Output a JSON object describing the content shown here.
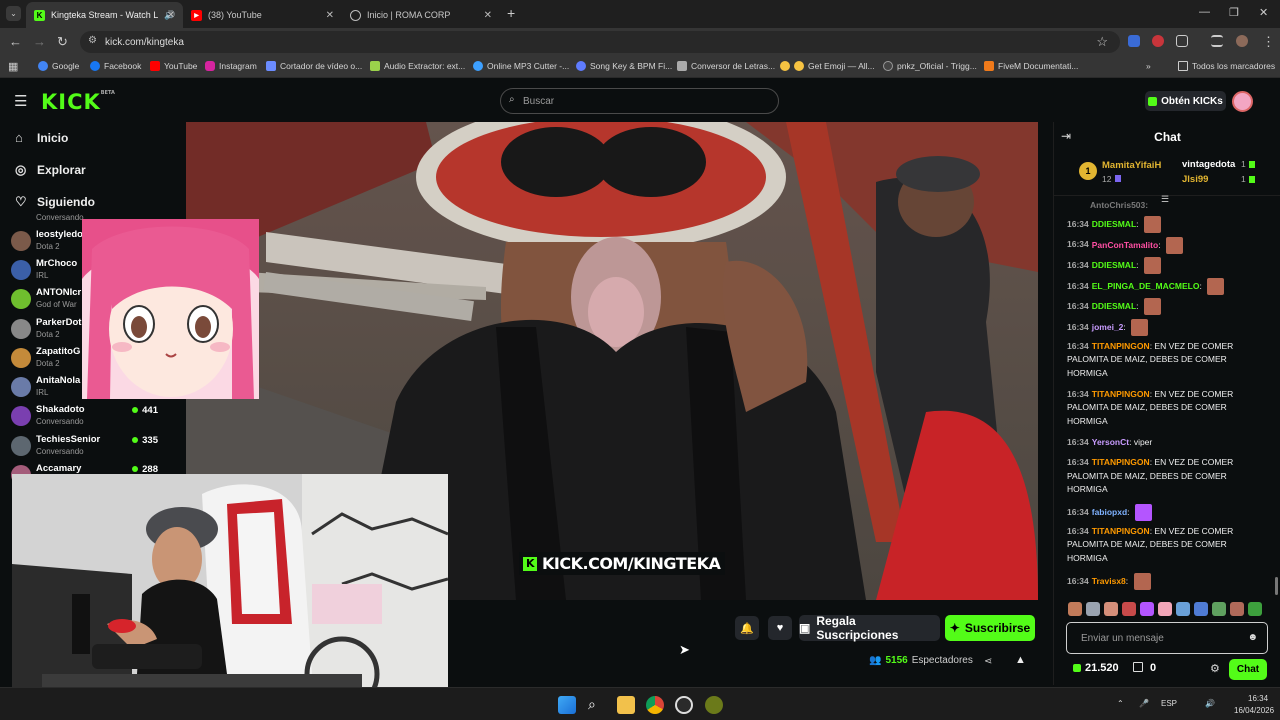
{
  "browser": {
    "tabs": [
      {
        "label": "Kingteka Stream - Watch L",
        "icon": "kick-favicon",
        "active": true
      },
      {
        "label": "(38) YouTube",
        "icon": "youtube-favicon",
        "active": false
      },
      {
        "label": "Inicio | ROMA CORP",
        "icon": "globe-favicon",
        "active": false
      }
    ],
    "url": "kick.com/kingteka",
    "bookmarks": [
      "Google",
      "Facebook",
      "YouTube",
      "Instagram",
      "Cortador de vídeo o...",
      "Audio Extractor: ext...",
      "Online MP3 Cutter -...",
      "Song Key & BPM Fi...",
      "Conversor de Letras...",
      "Get Emoji — All...",
      "pnkz_Oficial - Trigg...",
      "FiveM Documentati..."
    ],
    "all_bookmarks": "Todos los marcadores"
  },
  "header": {
    "logo": "KICK",
    "logo_sup": "BETA",
    "search_placeholder": "Buscar",
    "get_kicks": "Obtén KICKs"
  },
  "sidebar": {
    "nav": [
      {
        "label": "Inicio",
        "icon": "home-icon"
      },
      {
        "label": "Explorar",
        "icon": "compass-icon"
      },
      {
        "label": "Siguiendo",
        "icon": "heart-icon"
      }
    ],
    "top_fragment": "Conversando",
    "channels": [
      {
        "name": "leostyledo",
        "category": "Dota 2",
        "viewers": ""
      },
      {
        "name": "MrChoco",
        "category": "IRL",
        "viewers": ""
      },
      {
        "name": "ANTONIcr",
        "category": "God of War",
        "viewers": ""
      },
      {
        "name": "ParkerDot",
        "category": "Dota 2",
        "viewers": ""
      },
      {
        "name": "ZapatitoG",
        "category": "Dota 2",
        "viewers": ""
      },
      {
        "name": "AnitaNola",
        "category": "IRL",
        "viewers": ""
      },
      {
        "name": "Shakadoto",
        "category": "Conversando",
        "viewers": "441"
      },
      {
        "name": "TechiesSenior",
        "category": "Conversando",
        "viewers": "335"
      },
      {
        "name": "Accamary",
        "category": "",
        "viewers": "288"
      }
    ]
  },
  "video": {
    "overlay_text": "KICK.COM/KINGTEKA"
  },
  "actions": {
    "gift": "Regala Suscripciones",
    "subscribe": "Suscribirse",
    "viewers_count": "5156",
    "viewers_label": "Espectadores"
  },
  "chat": {
    "title": "Chat",
    "pinned": [
      {
        "rank": "1",
        "name": "MamitaYifaiH",
        "count": "12"
      },
      {
        "name": "vintagedota",
        "count": "1"
      },
      {
        "name": "Jlsi99",
        "count": "1"
      }
    ],
    "partial_top": "AntoChris503:",
    "messages": [
      {
        "time": "16:34",
        "user": "DDIESMAL",
        "color": "#53fc18",
        "text": "",
        "emote": true
      },
      {
        "time": "16:34",
        "user": "PanConTamalito",
        "color": "#ff4fa3",
        "text": "",
        "emote": true
      },
      {
        "time": "16:34",
        "user": "DDIESMAL",
        "color": "#53fc18",
        "text": "",
        "emote": true
      },
      {
        "time": "16:34",
        "user": "EL_PINGA_DE_MACMELO",
        "color": "#53fc18",
        "text": "",
        "emote": true
      },
      {
        "time": "16:34",
        "user": "DDIESMAL",
        "color": "#53fc18",
        "text": "",
        "emote": true
      },
      {
        "time": "16:34",
        "user": "jomei_2",
        "color": "#c99cff",
        "text": "",
        "emote": true
      },
      {
        "time": "16:34",
        "user": "TITANPINGON",
        "color": "#ff9a00",
        "text": "EN VEZ DE COMER PALOMITA DE MAIZ, DEBES DE COMER HORMIGA",
        "emote": false
      },
      {
        "time": "16:34",
        "user": "TITANPINGON",
        "color": "#ff9a00",
        "text": "EN VEZ DE COMER PALOMITA DE MAIZ, DEBES DE COMER HORMIGA",
        "emote": false
      },
      {
        "time": "16:34",
        "user": "YersonCt",
        "color": "#c99cff",
        "text": "viper",
        "emote": false
      },
      {
        "time": "16:34",
        "user": "TITANPINGON",
        "color": "#ff9a00",
        "text": "EN VEZ DE COMER PALOMITA DE MAIZ, DEBES DE COMER HORMIGA",
        "emote": false
      },
      {
        "time": "16:34",
        "user": "fabiopxd",
        "color": "#7fb2ff",
        "text": "",
        "emote": true
      },
      {
        "time": "16:34",
        "user": "TITANPINGON",
        "color": "#ff9a00",
        "text": "EN VEZ DE COMER PALOMITA DE MAIZ, DEBES DE COMER HORMIGA",
        "emote": false
      },
      {
        "time": "16:34",
        "user": "Travisx8",
        "color": "#ff9a00",
        "text": "",
        "emote": true
      }
    ],
    "input_placeholder": "Enviar un mensaje",
    "kicks_balance": "21.520",
    "points": "0",
    "send_label": "Chat"
  },
  "taskbar": {
    "language": "ESP",
    "time": "16:34",
    "date": "16/04/2026"
  }
}
